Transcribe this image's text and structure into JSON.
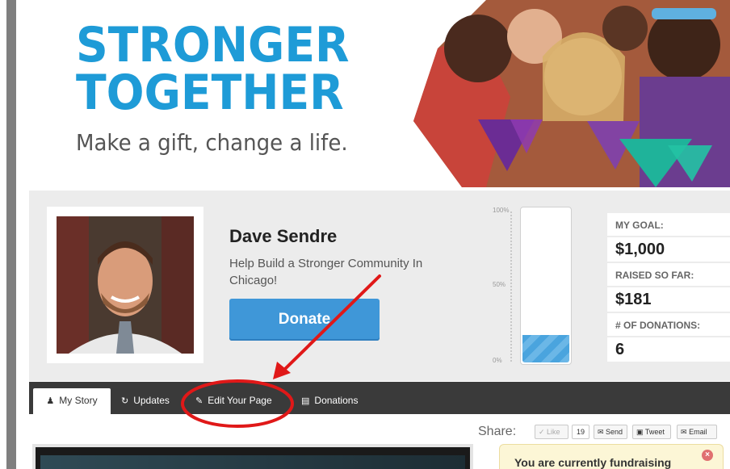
{
  "banner": {
    "logo_line1": "STRONGER",
    "logo_line2": "TOGETHER",
    "tagline": "Make a gift, change a life."
  },
  "profile": {
    "name": "Dave Sendre",
    "description": "Help Build a Stronger Community In Chicago!",
    "donate_label": "Donate"
  },
  "thermometer": {
    "ticks": [
      "100%",
      "50%",
      "0%"
    ],
    "progress_fraction": 0.181
  },
  "stats": {
    "goal_label": "MY GOAL:",
    "goal_value": "$1,000",
    "raised_label": "RAISED SO FAR:",
    "raised_value": "$181",
    "donations_label": "# OF DONATIONS:",
    "donations_value": "6"
  },
  "tabs": [
    {
      "label": "My Story",
      "icon": "user-icon",
      "active": true
    },
    {
      "label": "Updates",
      "icon": "refresh-icon"
    },
    {
      "label": "Edit Your Page",
      "icon": "edit-icon"
    },
    {
      "label": "Donations",
      "icon": "list-icon"
    }
  ],
  "share": {
    "label": "Share:",
    "like": "Like",
    "like_count": "19",
    "send": "Send",
    "tweet": "Tweet",
    "email": "Email"
  },
  "notice": {
    "text": "You are currently fundraising"
  },
  "colors": {
    "brand_blue": "#1e9bd7",
    "button_blue": "#3f97d8",
    "annotation_red": "#e01818",
    "tabbar": "#3a3a3a"
  }
}
